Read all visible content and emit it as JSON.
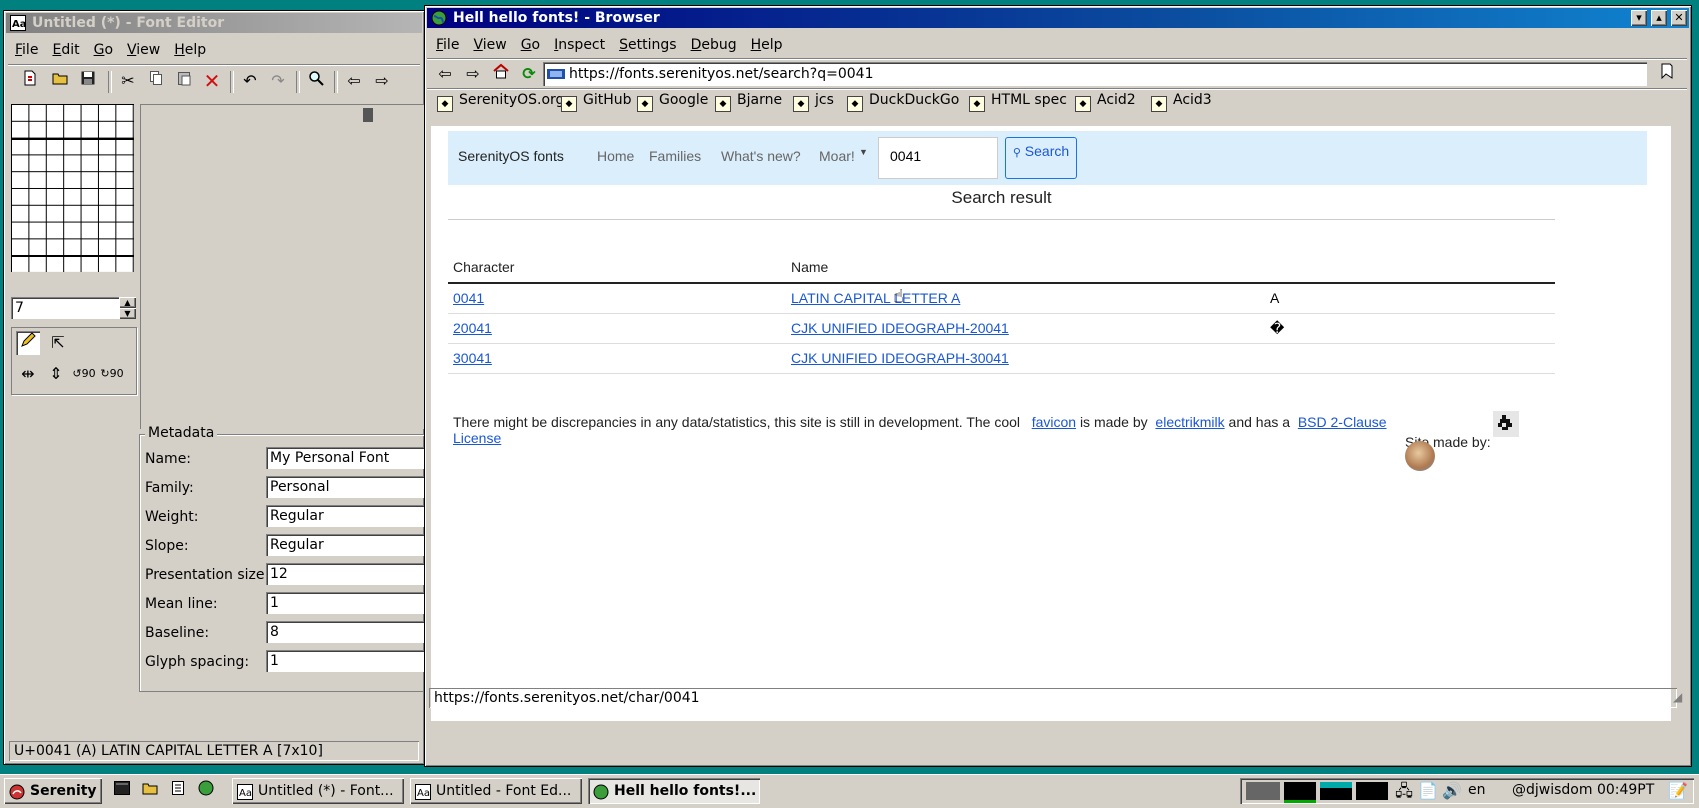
{
  "desktop": {
    "background_color": "#00807f"
  },
  "font_editor": {
    "title": "Untitled (*) - Font Editor",
    "menu": [
      "File",
      "Edit",
      "Go",
      "View",
      "Help"
    ],
    "glyph_width_value": "7",
    "metadata": {
      "group_title": "Metadata",
      "fields": [
        {
          "label": "Name:",
          "value": "My Personal Font"
        },
        {
          "label": "Family:",
          "value": "Personal"
        },
        {
          "label": "Weight:",
          "value": "Regular"
        },
        {
          "label": "Slope:",
          "value": "Regular"
        },
        {
          "label": "Presentation size:",
          "value": "12"
        },
        {
          "label": "Mean line:",
          "value": "1"
        },
        {
          "label": "Baseline:",
          "value": "8"
        },
        {
          "label": "Glyph spacing:",
          "value": "1"
        }
      ]
    },
    "status": "U+0041 (A) LATIN CAPITAL LETTER A [7x10]",
    "icons": [
      "new-file-icon",
      "open-folder-icon",
      "save-icon",
      "cut-icon",
      "copy-icon",
      "paste-icon",
      "delete-icon",
      "undo-icon",
      "redo-icon",
      "search-icon",
      "previous-icon",
      "next-icon"
    ]
  },
  "browser": {
    "title": "Hell hello fonts! - Browser",
    "menu": [
      "File",
      "View",
      "Go",
      "Inspect",
      "Settings",
      "Debug",
      "Help"
    ],
    "url": "https://fonts.serenityos.net/search?q=0041",
    "bookmarks": [
      "SerenityOS.org",
      "GitHub",
      "Google",
      "Bjarne",
      "jcs",
      "DuckDuckGo",
      "HTML spec",
      "Acid2",
      "Acid3"
    ],
    "status": "https://fonts.serenityos.net/char/0041",
    "page": {
      "brand": "SerenityOS fonts",
      "nav": [
        "Home",
        "Families",
        "What's new?",
        "Moar!"
      ],
      "search_value": "0041",
      "search_button": "Search",
      "heading": "Search result",
      "columns": [
        "Character",
        "Name"
      ],
      "rows": [
        {
          "code": "0041",
          "name": "LATIN CAPITAL LETTER A",
          "glyph": "A"
        },
        {
          "code": "20041",
          "name": "CJK UNIFIED IDEOGRAPH-20041",
          "glyph": "�"
        },
        {
          "code": "30041",
          "name": "CJK UNIFIED IDEOGRAPH-30041",
          "glyph": ""
        }
      ],
      "footer": {
        "text_before": "There might be discrepancies in any data/statistics, this site is still in development. The cool",
        "favicon_link": "favicon",
        "made_by_text": "is made by",
        "author_link": "electrikmilk",
        "license_text": "and has a",
        "license_link_1": "BSD 2-Clause",
        "license_link_2": "License",
        "site_made_by": "Site made by:"
      },
      "colors": {
        "navbar_bg": "#dbeefb",
        "link": "#1a57d6",
        "button_border": "#1a73e8"
      }
    }
  },
  "taskbar": {
    "start": "Serenity",
    "tasks": [
      "Untitled (*) - Font...",
      "Untitled - Font Ed...",
      "Hell hello fonts!..."
    ],
    "keyboard": "en",
    "clock": "@djwisdom 00:49PT"
  }
}
